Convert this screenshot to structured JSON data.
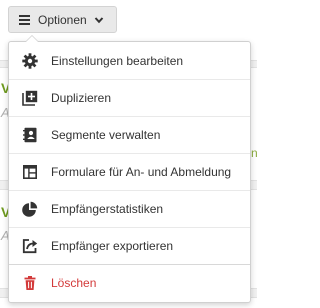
{
  "button": {
    "label": "Optionen"
  },
  "menu": {
    "items": [
      {
        "label": "Einstellungen bearbeiten",
        "icon": "gear-icon"
      },
      {
        "label": "Duplizieren",
        "icon": "duplicate-icon"
      },
      {
        "label": "Segmente verwalten",
        "icon": "address-book-icon"
      },
      {
        "label": "Formulare für An- und Abmeldung",
        "icon": "form-layout-icon"
      },
      {
        "label": "Empfängerstatistiken",
        "icon": "pie-chart-icon"
      },
      {
        "label": "Empfänger exportieren",
        "icon": "export-icon"
      },
      {
        "label": "Löschen",
        "icon": "trash-icon"
      }
    ]
  },
  "background": {
    "letter_1": "V",
    "italic_1": "A",
    "letter_2": "V",
    "italic_2": "A",
    "green_fragment": "n"
  },
  "colors": {
    "text": "#333333",
    "danger": "#d33a3a",
    "accent": "#6e9a1e"
  }
}
